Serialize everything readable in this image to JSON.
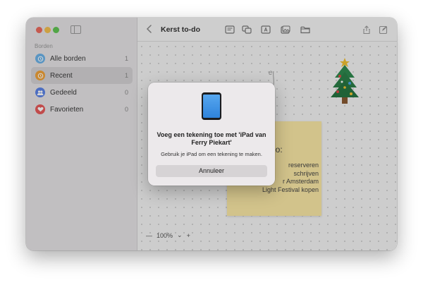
{
  "sidebar": {
    "section_label": "Borden",
    "items": [
      {
        "label": "Alle borden",
        "count": "1",
        "icon": "clock-icon",
        "color": "#6cb2e8"
      },
      {
        "label": "Recent",
        "count": "1",
        "icon": "clock-icon",
        "color": "#f0a23a"
      },
      {
        "label": "Gedeeld",
        "count": "0",
        "icon": "people-icon",
        "color": "#5c84e6"
      },
      {
        "label": "Favorieten",
        "count": "0",
        "icon": "heart-icon",
        "color": "#e65a5a"
      }
    ]
  },
  "toolbar": {
    "title": "Kerst to-do"
  },
  "canvas": {
    "sticky_title": "to-do:",
    "sticky_lines": [
      "reserveren",
      "schrijven",
      "r Amsterdam",
      "Light Festival kopen"
    ],
    "doodle": "e",
    "zoom": "100%"
  },
  "dialog": {
    "title": "Voeg een tekening toe met 'iPad van Ferry Piekart'",
    "message": "Gebruik je iPad om een tekening te maken.",
    "cancel_label": "Annuleer"
  },
  "colors": {
    "accent_close": "#ec6a5e",
    "accent_min": "#f4bf4f",
    "accent_max": "#61c554",
    "sticky": "#fbe9a6"
  }
}
